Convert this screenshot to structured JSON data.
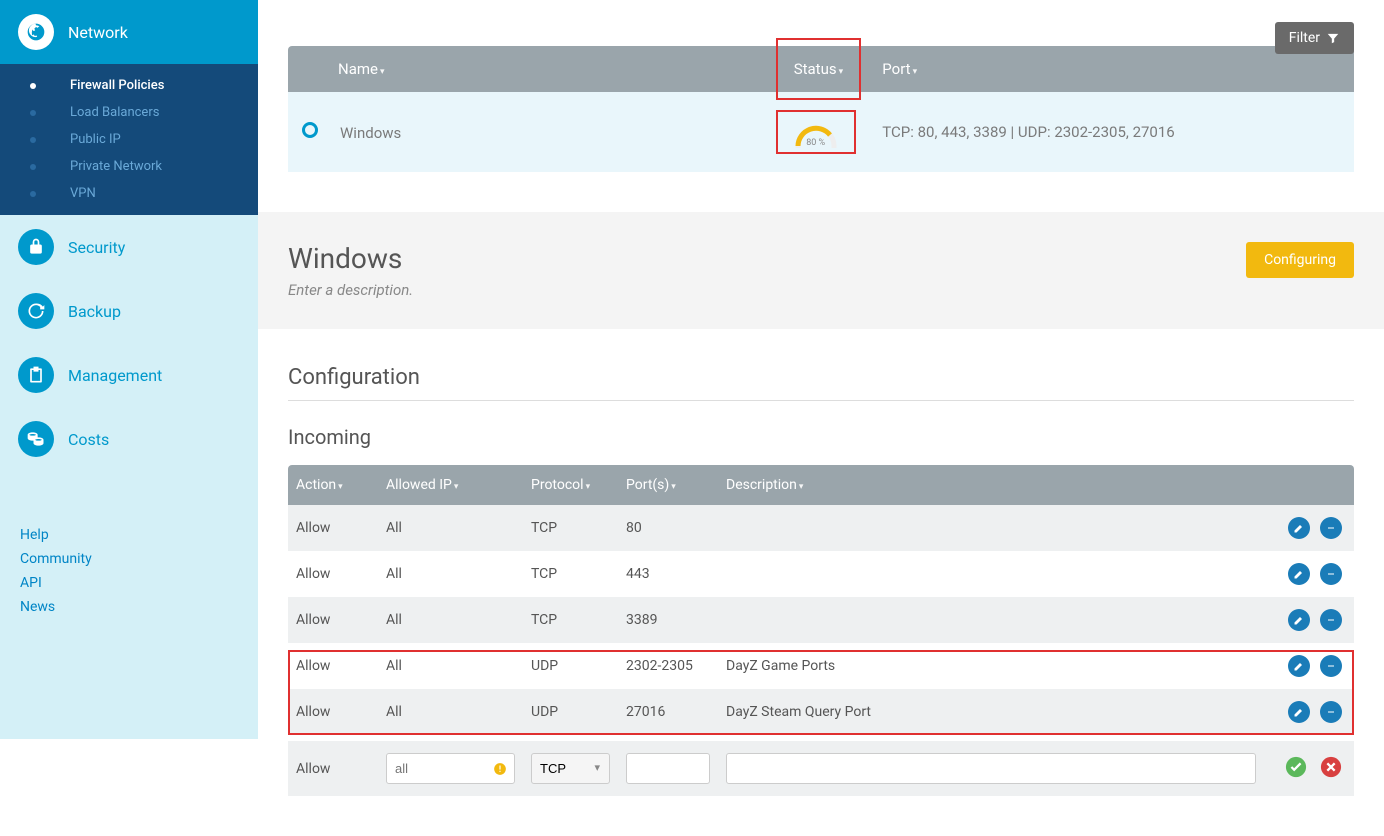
{
  "sidebar": {
    "network": {
      "label": "Network",
      "items": [
        {
          "label": "Firewall Policies",
          "active": true
        },
        {
          "label": "Load Balancers"
        },
        {
          "label": "Public IP"
        },
        {
          "label": "Private Network"
        },
        {
          "label": "VPN"
        }
      ]
    },
    "security": {
      "label": "Security"
    },
    "backup": {
      "label": "Backup"
    },
    "management": {
      "label": "Management"
    },
    "costs": {
      "label": "Costs"
    }
  },
  "footer": {
    "help": "Help",
    "community": "Community",
    "api": "API",
    "news": "News"
  },
  "filter_btn": "Filter",
  "list": {
    "cols": {
      "name": "Name",
      "status": "Status",
      "port": "Port"
    },
    "row": {
      "name": "Windows",
      "status_pct": "80 %",
      "port": "TCP: 80, 443, 3389 | UDP: 2302-2305, 27016"
    }
  },
  "detail": {
    "title": "Windows",
    "desc_placeholder": "Enter a description.",
    "status": "Configuring",
    "config": "Configuration",
    "incoming": "Incoming"
  },
  "rules": {
    "cols": {
      "action": "Action",
      "ip": "Allowed IP",
      "proto": "Protocol",
      "ports": "Port(s)",
      "desc": "Description"
    },
    "rows": [
      {
        "action": "Allow",
        "ip": "All",
        "proto": "TCP",
        "ports": "80",
        "desc": ""
      },
      {
        "action": "Allow",
        "ip": "All",
        "proto": "TCP",
        "ports": "443",
        "desc": ""
      },
      {
        "action": "Allow",
        "ip": "All",
        "proto": "TCP",
        "ports": "3389",
        "desc": ""
      },
      {
        "action": "Allow",
        "ip": "All",
        "proto": "UDP",
        "ports": "2302-2305",
        "desc": "DayZ Game Ports"
      },
      {
        "action": "Allow",
        "ip": "All",
        "proto": "UDP",
        "ports": "27016",
        "desc": "DayZ Steam Query Port"
      }
    ],
    "new": {
      "action": "Allow",
      "ip_placeholder": "all",
      "proto": "TCP"
    }
  }
}
